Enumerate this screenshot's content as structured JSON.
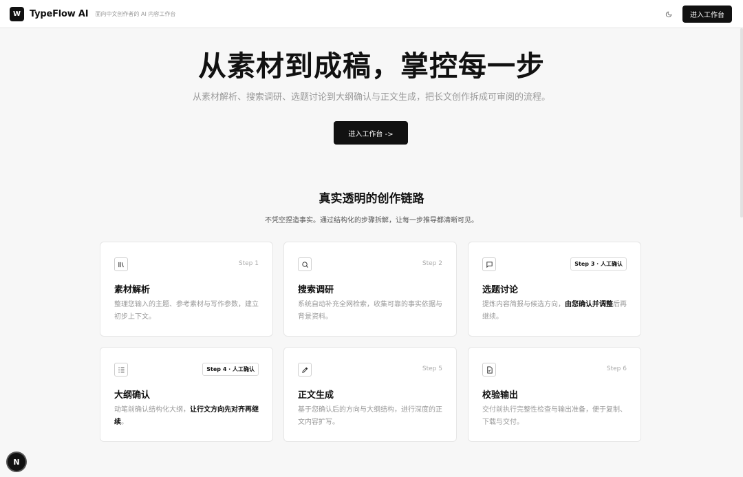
{
  "header": {
    "logo_letter": "W",
    "brand": "TypeFlow AI",
    "tagline": "面向中文创作者的 AI 内容工作台",
    "theme_icon": "moon-icon",
    "enter_label": "进入工作台"
  },
  "hero": {
    "title": "从素材到成稿，掌控每一步",
    "subtitle": "从素材解析、搜索调研、选题讨论到大纲确认与正文生成，把长文创作拆成可审阅的流程。",
    "cta_label": "进入工作台 ->"
  },
  "section": {
    "title": "真实透明的创作链路",
    "subtitle": "不凭空捏造事实。通过结构化的步骤拆解，让每一步推导都清晰可见。"
  },
  "steps": [
    {
      "icon": "library-icon",
      "step": "Step 1",
      "title": "素材解析",
      "desc": "整理您输入的主题、参考素材与写作参数，建立初步上下文。",
      "desc_bold": "",
      "desc_after": ""
    },
    {
      "icon": "search-icon",
      "step": "Step 2",
      "title": "搜索调研",
      "desc": "系统自动补充全网检索，收集可靠的事实依据与背景资料。",
      "desc_bold": "",
      "desc_after": ""
    },
    {
      "icon": "message-icon",
      "step": "Step 3 · 人工确认",
      "title": "选题讨论",
      "desc": "提炼内容简报与候选方向，",
      "desc_bold": "由您确认并调整",
      "desc_after": "后再继续。"
    },
    {
      "icon": "list-icon",
      "step": "Step 4 · 人工确认",
      "title": "大纲确认",
      "desc": "动笔前确认结构化大纲，",
      "desc_bold": "让行文方向先对齐再继续",
      "desc_after": "。"
    },
    {
      "icon": "pen-icon",
      "step": "Step 5",
      "title": "正文生成",
      "desc": "基于您确认后的方向与大纲结构，进行深度的正文内容扩写。",
      "desc_bold": "",
      "desc_after": ""
    },
    {
      "icon": "file-check-icon",
      "step": "Step 6",
      "title": "校验输出",
      "desc": "交付前执行完整性检查与输出准备，便于复制、下载与交付。",
      "desc_bold": "",
      "desc_after": ""
    }
  ],
  "floating_badge": "N"
}
